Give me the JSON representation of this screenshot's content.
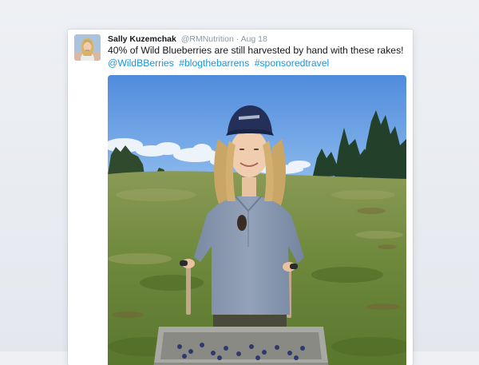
{
  "tweet": {
    "author_name": "Sally Kuzemchak",
    "author_handle": "@RMNutrition",
    "separator": "·",
    "date": "Aug 18",
    "text": "40% of Wild Blueberries are still harvested by hand with these rakes!",
    "hashtags": [
      "@WildBBerries",
      "#blogthebarrens",
      "#sponsoredtravel"
    ]
  },
  "colors": {
    "link": "#1b95e0",
    "text": "#14171a",
    "muted": "#8899a6",
    "sky": "#5e97e2",
    "field": "#6d8a3a",
    "shirt": "#8796ad",
    "cap": "#1f2a4c"
  }
}
